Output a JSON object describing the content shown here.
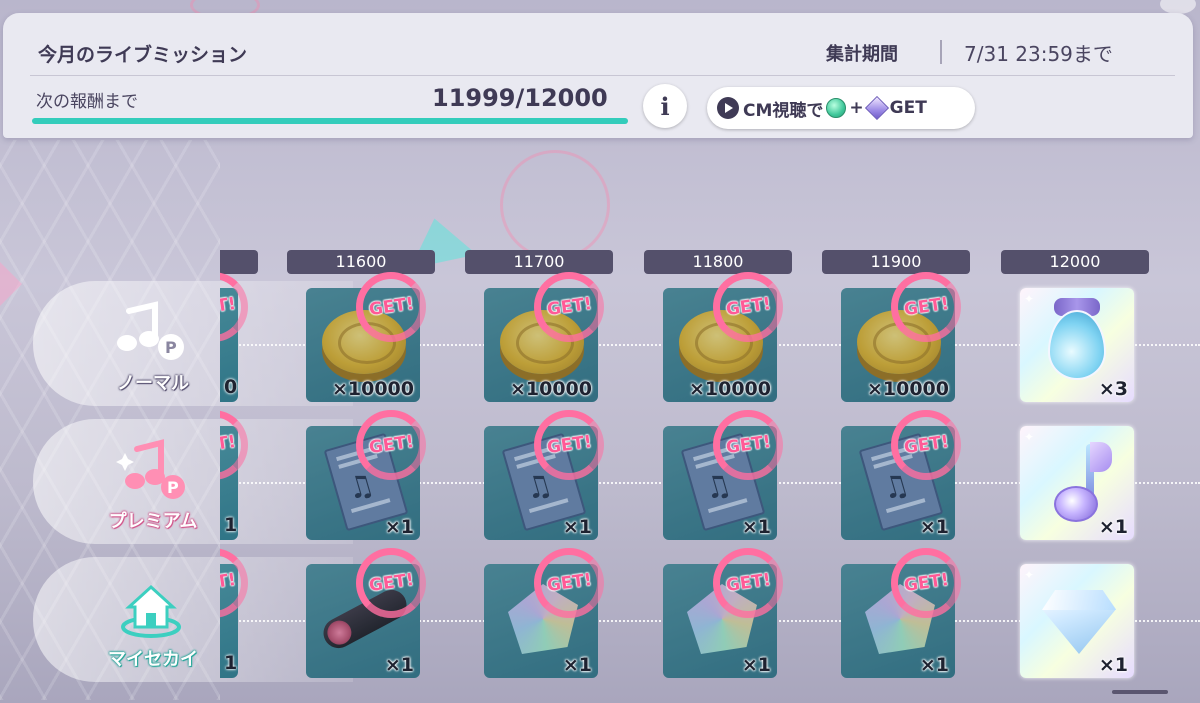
{
  "header": {
    "title": "今月のライブミッション",
    "period_label": "集計期間",
    "period_value": "7/31 23:59まで",
    "next_reward_label": "次の報酬まで",
    "progress_text": "11999/12000",
    "progress_fraction": 0.99992,
    "info_label": "i",
    "cm_button": {
      "prefix": "CM視聴で",
      "plus": "+",
      "suffix": "GET"
    }
  },
  "tiers": [
    {
      "label": "ノーマル",
      "icon": "music-note-p-icon"
    },
    {
      "label": "プレミアム",
      "icon": "sparkle-music-note-p-icon"
    },
    {
      "label": "マイセカイ",
      "icon": "house-icon"
    }
  ],
  "get_label": "GET!",
  "columns": [
    {
      "points": "",
      "partial_qty": [
        "0",
        "1",
        "1"
      ]
    },
    {
      "points": "11600"
    },
    {
      "points": "11700"
    },
    {
      "points": "11800"
    },
    {
      "points": "11900"
    },
    {
      "points": "12000"
    }
  ],
  "rewards": {
    "normal": [
      {
        "item": "coin-icon",
        "qty": "×10000",
        "claimed": true
      },
      {
        "item": "coin-icon",
        "qty": "×10000",
        "claimed": true
      },
      {
        "item": "coin-icon",
        "qty": "×10000",
        "claimed": true
      },
      {
        "item": "coin-icon",
        "qty": "×10000",
        "claimed": true
      },
      {
        "item": "water-drop-icon",
        "qty": "×3",
        "claimed": false
      }
    ],
    "premium": [
      {
        "item": "music-score-icon",
        "qty": "×1",
        "claimed": true
      },
      {
        "item": "music-score-icon",
        "qty": "×1",
        "claimed": true
      },
      {
        "item": "music-score-icon",
        "qty": "×1",
        "claimed": true
      },
      {
        "item": "music-score-icon",
        "qty": "×1",
        "claimed": true
      },
      {
        "item": "gem-note-icon",
        "qty": "×1",
        "claimed": false
      }
    ],
    "sekai": [
      {
        "item": "log-icon",
        "qty": "×1",
        "claimed": true
      },
      {
        "item": "rainbow-crystal-icon",
        "qty": "×1",
        "claimed": true
      },
      {
        "item": "rainbow-crystal-icon",
        "qty": "×1",
        "claimed": true
      },
      {
        "item": "rainbow-crystal-icon",
        "qty": "×1",
        "claimed": true
      },
      {
        "item": "diamond-icon",
        "qty": "×1",
        "claimed": false
      }
    ]
  },
  "colors": {
    "accent_teal": "#33ccbb",
    "get_pink": "#ff6fa1",
    "header_bg": "#e9e9f1",
    "column_header_bg": "#54506b"
  }
}
